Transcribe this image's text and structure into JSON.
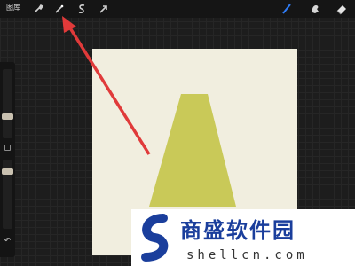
{
  "topbar": {
    "gallery_label": "图库",
    "left_tools": [
      "wrench-icon",
      "magic-wand-icon",
      "selection-icon",
      "transform-arrow-icon"
    ],
    "right_tools": [
      "brush-icon",
      "smudge-icon",
      "eraser-icon"
    ],
    "active_tool_color": "#2f7cf6"
  },
  "sidebar": {
    "brush_size_label": "",
    "opacity_label": "",
    "undo_icon": "undo-icon"
  },
  "canvas": {
    "background_color": "#f1eedf",
    "shape_color": "#c9c958"
  },
  "annotation": {
    "arrow_color": "#e03a3a"
  },
  "watermark": {
    "brand": "商盛软件园",
    "url": "shellcn.com",
    "brand_color": "#1a3e9c"
  }
}
